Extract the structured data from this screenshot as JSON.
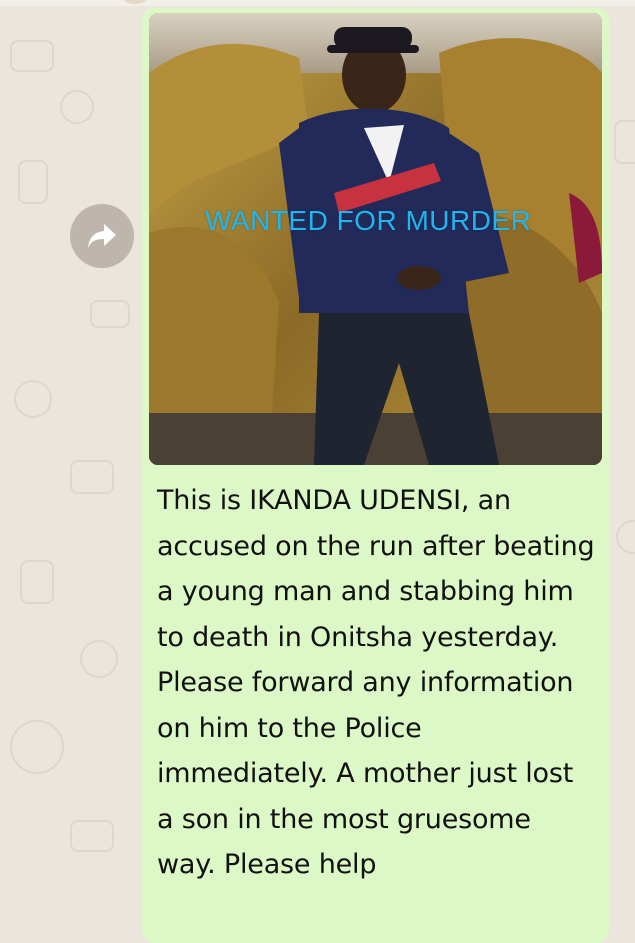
{
  "message": {
    "image_caption": "WANTED FOR MURDER",
    "text": "This is IKANDA UDENSI, an accused on the run after beating a young man and stabbing him to death in Onitsha yesterday. Please forward any information on him to the Police immediately. A mother just lost a son in the most gruesome way. Please help",
    "bubble_color": "#dcf8c6",
    "caption_color": "#1fb6f0"
  },
  "actions": {
    "forward_icon": "forward-arrow-icon"
  },
  "background": {
    "color": "#ece5dd"
  }
}
